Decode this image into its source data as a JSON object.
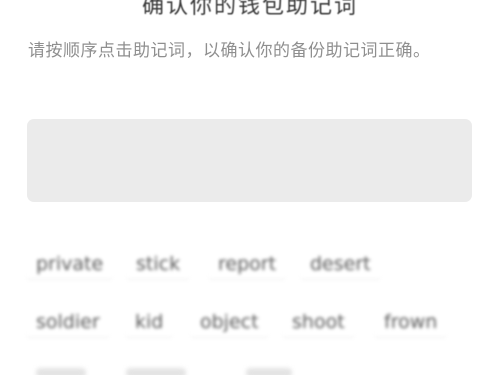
{
  "header": {
    "title": "确认你的钱包助记词"
  },
  "instructions": "请按顺序点击助记词，以确认你的备份助记词正确。",
  "answer_box": {
    "selected_words": []
  },
  "word_chips": [
    {
      "label": "private"
    },
    {
      "label": "stick"
    },
    {
      "label": "report"
    },
    {
      "label": "desert"
    },
    {
      "label": "soldier"
    },
    {
      "label": "kid"
    },
    {
      "label": "object"
    },
    {
      "label": "shoot"
    },
    {
      "label": "frown"
    }
  ],
  "colors": {
    "background": "#ffffff",
    "answer_box": "#ebebeb",
    "title_text": "#3a3a3a",
    "hint_text": "#8f8f8f"
  }
}
